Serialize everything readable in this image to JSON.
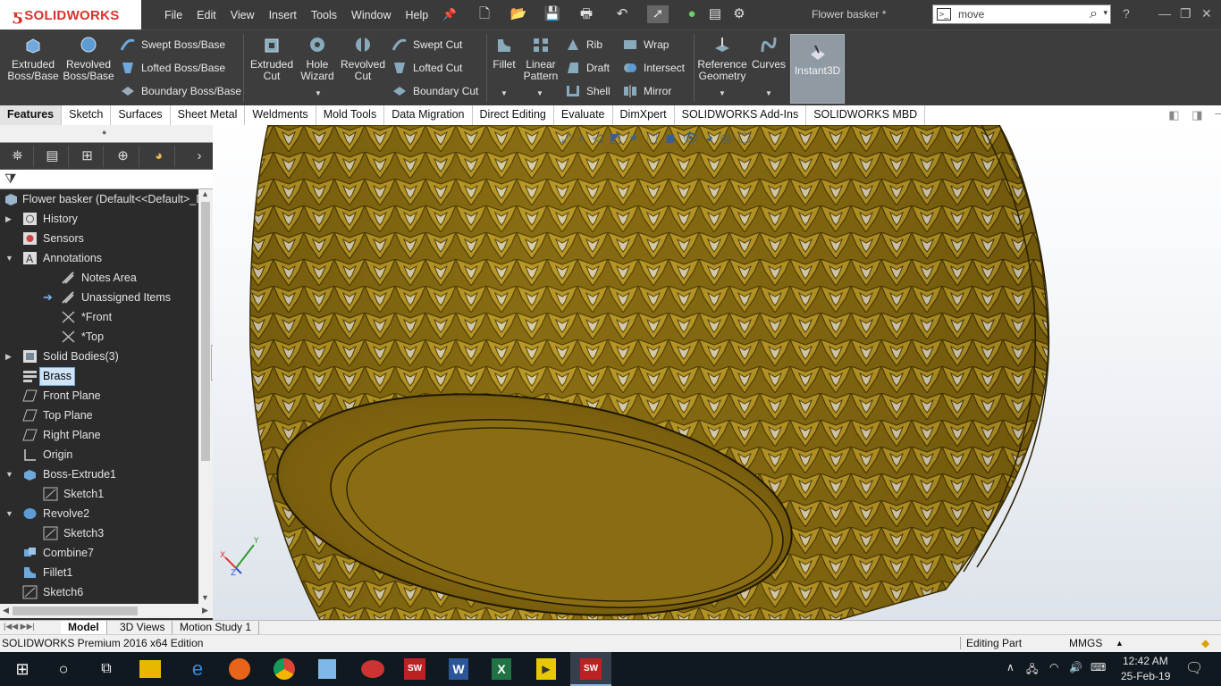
{
  "app": {
    "brand": "SOLIDWORKS",
    "document_title": "Flower basker *"
  },
  "menu": [
    "File",
    "Edit",
    "View",
    "Insert",
    "Tools",
    "Window",
    "Help"
  ],
  "search": {
    "value": "move"
  },
  "command_manager": {
    "extruded_boss": "Extruded Boss/Base",
    "revolved_boss": "Revolved Boss/Base",
    "swept_boss": "Swept Boss/Base",
    "lofted_boss": "Lofted Boss/Base",
    "boundary_boss": "Boundary Boss/Base",
    "extruded_cut": "Extruded Cut",
    "hole_wizard": "Hole Wizard",
    "revolved_cut": "Revolved Cut",
    "swept_cut": "Swept Cut",
    "lofted_cut": "Lofted Cut",
    "boundary_cut": "Boundary Cut",
    "fillet": "Fillet",
    "linear_pattern": "Linear Pattern",
    "rib": "Rib",
    "draft": "Draft",
    "shell": "Shell",
    "wrap": "Wrap",
    "intersect": "Intersect",
    "mirror": "Mirror",
    "reference_geometry": "Reference Geometry",
    "curves": "Curves",
    "instant3d": "Instant3D"
  },
  "tabs": [
    "Features",
    "Sketch",
    "Surfaces",
    "Sheet Metal",
    "Weldments",
    "Mold Tools",
    "Data Migration",
    "Direct Editing",
    "Evaluate",
    "DimXpert",
    "SOLIDWORKS Add-Ins",
    "SOLIDWORKS MBD"
  ],
  "tree": {
    "root": "Flower basker  (Default<<Default>_Di",
    "items": [
      {
        "label": "History"
      },
      {
        "label": "Sensors"
      },
      {
        "label": "Annotations"
      },
      {
        "label": "Notes Area"
      },
      {
        "label": "Unassigned Items"
      },
      {
        "label": "*Front"
      },
      {
        "label": "*Top"
      },
      {
        "label": "Solid Bodies(3)"
      },
      {
        "label": "Brass"
      },
      {
        "label": "Front Plane"
      },
      {
        "label": "Top Plane"
      },
      {
        "label": "Right Plane"
      },
      {
        "label": "Origin"
      },
      {
        "label": "Boss-Extrude1"
      },
      {
        "label": "Sketch1"
      },
      {
        "label": "Revolve2"
      },
      {
        "label": "Sketch3"
      },
      {
        "label": "Combine7"
      },
      {
        "label": "Fillet1"
      },
      {
        "label": "Sketch6"
      }
    ]
  },
  "bottom_tabs": [
    "Model",
    "3D Views",
    "Motion Study 1"
  ],
  "status": {
    "edition": "SOLIDWORKS Premium 2016 x64 Edition",
    "mode": "Editing Part",
    "units": "MMGS"
  },
  "taskbar": {
    "time": "12:42 AM",
    "date": "25-Feb-19"
  },
  "colors": {
    "brass": "#8a6d12",
    "brass_light": "#c9a92a",
    "brand_red": "#d9322a"
  }
}
